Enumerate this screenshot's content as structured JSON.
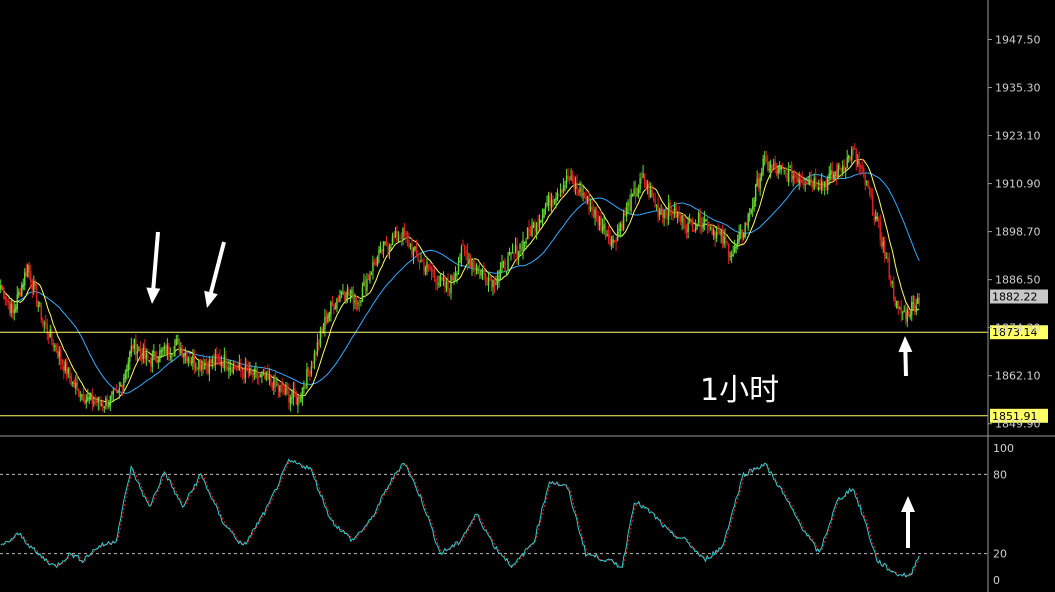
{
  "chart_data": [
    {
      "type": "candlestick",
      "ylim": [
        1845,
        1955
      ],
      "y_ticks": [
        "1947.50",
        "1935.30",
        "1923.10",
        "1910.90",
        "1898.70",
        "1886.50",
        "1874.30",
        "1862.10",
        "1849.90"
      ],
      "current_price_tag": "1882.22",
      "horizontal_lines": [
        {
          "value": 1873.14,
          "label": "1873.14",
          "color": "#ffff66"
        },
        {
          "value": 1851.91,
          "label": "1851.91",
          "color": "#ffff66"
        }
      ],
      "annotation_text": "1小时",
      "candle_up_color": "#66dd33",
      "candle_down_color": "#e02020",
      "ma_fast_color": "#ffff66",
      "ma_slow_color": "#33aaff",
      "path_anchors": [
        [
          0,
          1885
        ],
        [
          8,
          1878
        ],
        [
          18,
          1890
        ],
        [
          28,
          1876
        ],
        [
          38,
          1868
        ],
        [
          48,
          1860
        ],
        [
          58,
          1856
        ],
        [
          68,
          1855
        ],
        [
          78,
          1857
        ],
        [
          88,
          1870
        ],
        [
          98,
          1866
        ],
        [
          108,
          1868
        ],
        [
          118,
          1870
        ],
        [
          128,
          1866
        ],
        [
          138,
          1865
        ],
        [
          148,
          1866
        ],
        [
          158,
          1864
        ],
        [
          168,
          1862
        ],
        [
          178,
          1861
        ],
        [
          188,
          1858
        ],
        [
          198,
          1856
        ],
        [
          208,
          1866
        ],
        [
          218,
          1878
        ],
        [
          228,
          1884
        ],
        [
          238,
          1881
        ],
        [
          248,
          1890
        ],
        [
          258,
          1896
        ],
        [
          268,
          1898
        ],
        [
          278,
          1892
        ],
        [
          288,
          1888
        ],
        [
          298,
          1884
        ],
        [
          308,
          1894
        ],
        [
          318,
          1889
        ],
        [
          328,
          1886
        ],
        [
          338,
          1891
        ],
        [
          348,
          1896
        ],
        [
          358,
          1902
        ],
        [
          368,
          1908
        ],
        [
          378,
          1912
        ],
        [
          388,
          1908
        ],
        [
          398,
          1902
        ],
        [
          408,
          1896
        ],
        [
          418,
          1905
        ],
        [
          428,
          1912
        ],
        [
          438,
          1904
        ],
        [
          448,
          1904
        ],
        [
          458,
          1900
        ],
        [
          468,
          1902
        ],
        [
          478,
          1898
        ],
        [
          488,
          1893
        ],
        [
          498,
          1902
        ],
        [
          508,
          1916
        ],
        [
          518,
          1914
        ],
        [
          528,
          1913
        ],
        [
          538,
          1912
        ],
        [
          548,
          1911
        ],
        [
          558,
          1914
        ],
        [
          568,
          1919
        ],
        [
          578,
          1909
        ],
        [
          588,
          1895
        ],
        [
          598,
          1878
        ],
        [
          604,
          1878
        ],
        [
          612,
          1882
        ]
      ]
    },
    {
      "type": "line",
      "indicator": "oscillator",
      "ylim": [
        0,
        100
      ],
      "y_ticks": [
        "100",
        "80",
        "20",
        "0"
      ],
      "levels": [
        80,
        20
      ],
      "main_color": "#33cccc",
      "signal_color": "#e02020",
      "path_anchors": [
        [
          0,
          25
        ],
        [
          12,
          35
        ],
        [
          24,
          20
        ],
        [
          36,
          10
        ],
        [
          46,
          20
        ],
        [
          54,
          15
        ],
        [
          64,
          25
        ],
        [
          76,
          30
        ],
        [
          86,
          85
        ],
        [
          98,
          55
        ],
        [
          108,
          82
        ],
        [
          120,
          55
        ],
        [
          132,
          80
        ],
        [
          146,
          45
        ],
        [
          160,
          25
        ],
        [
          176,
          55
        ],
        [
          190,
          90
        ],
        [
          204,
          85
        ],
        [
          218,
          45
        ],
        [
          232,
          30
        ],
        [
          244,
          45
        ],
        [
          256,
          72
        ],
        [
          266,
          90
        ],
        [
          278,
          60
        ],
        [
          290,
          20
        ],
        [
          302,
          28
        ],
        [
          314,
          50
        ],
        [
          326,
          25
        ],
        [
          338,
          10
        ],
        [
          352,
          30
        ],
        [
          362,
          75
        ],
        [
          374,
          70
        ],
        [
          386,
          20
        ],
        [
          400,
          15
        ],
        [
          410,
          10
        ],
        [
          418,
          60
        ],
        [
          430,
          50
        ],
        [
          442,
          35
        ],
        [
          452,
          30
        ],
        [
          464,
          15
        ],
        [
          476,
          25
        ],
        [
          490,
          80
        ],
        [
          504,
          88
        ],
        [
          514,
          70
        ],
        [
          526,
          45
        ],
        [
          540,
          20
        ],
        [
          552,
          60
        ],
        [
          562,
          70
        ],
        [
          570,
          45
        ],
        [
          578,
          15
        ],
        [
          590,
          5
        ],
        [
          600,
          3
        ],
        [
          606,
          20
        ]
      ]
    }
  ]
}
